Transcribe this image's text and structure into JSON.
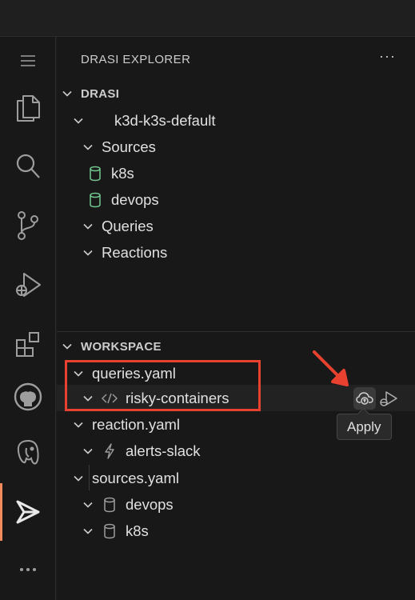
{
  "colors": {
    "accent": "#f28a5b",
    "highlight": "#e8412f",
    "db_green": "#73c991"
  },
  "activity_bar": {
    "items": [
      {
        "name": "menu-icon"
      },
      {
        "name": "explorer-icon"
      },
      {
        "name": "search-icon"
      },
      {
        "name": "source-control-icon"
      },
      {
        "name": "run-debug-icon"
      },
      {
        "name": "extensions-icon"
      },
      {
        "name": "github-icon"
      },
      {
        "name": "postgresql-icon"
      },
      {
        "name": "drasi-icon"
      },
      {
        "name": "more-icon"
      }
    ],
    "active": "drasi-icon"
  },
  "sidebar": {
    "title": "DRASI EXPLORER",
    "more": "···",
    "drasi_section": {
      "title": "DRASI",
      "cluster": "k3d-k3s-default",
      "sources_label": "Sources",
      "sources": [
        "k8s",
        "devops"
      ],
      "queries_label": "Queries",
      "reactions_label": "Reactions"
    },
    "workspace_section": {
      "title": "WORKSPACE",
      "files": [
        {
          "name": "queries.yaml",
          "children": [
            {
              "name": "risky-containers",
              "icon": "code-icon"
            }
          ]
        },
        {
          "name": "reaction.yaml",
          "children": [
            {
              "name": "alerts-slack",
              "icon": "lightning-icon"
            }
          ]
        },
        {
          "name": "sources.yaml",
          "children": [
            {
              "name": "devops",
              "icon": "database-icon"
            },
            {
              "name": "k8s",
              "icon": "database-icon"
            }
          ]
        }
      ]
    }
  },
  "tooltip": {
    "label": "Apply"
  }
}
